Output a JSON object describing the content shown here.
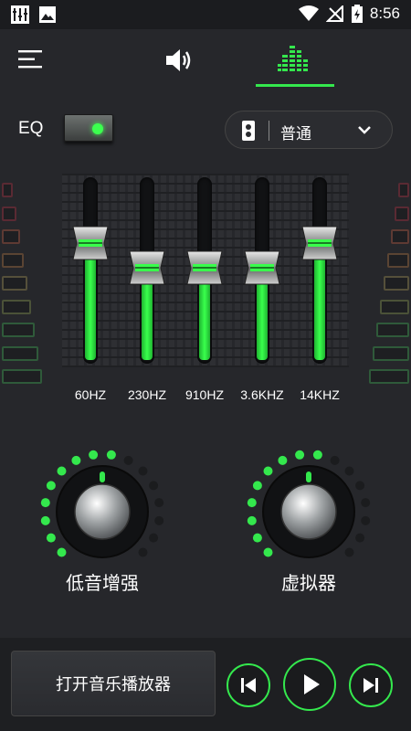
{
  "status_bar": {
    "time": "8:56"
  },
  "header": {
    "tabs": [
      {
        "icon": "speaker-icon",
        "active": false
      },
      {
        "icon": "equalizer-icon",
        "active": true
      }
    ]
  },
  "eq": {
    "label": "EQ",
    "enabled": true,
    "preset": {
      "value": "普通"
    },
    "bands": [
      {
        "label": "60HZ",
        "level": 0.64
      },
      {
        "label": "230HZ",
        "level": 0.5
      },
      {
        "label": "910HZ",
        "level": 0.5
      },
      {
        "label": "3.6KHZ",
        "level": 0.5
      },
      {
        "label": "14KHZ",
        "level": 0.64
      }
    ]
  },
  "knobs": [
    {
      "label": "低音增强",
      "dots_lit": 9,
      "dots_total": 16
    },
    {
      "label": "虚拟器",
      "dots_lit": 9,
      "dots_total": 16
    }
  ],
  "player": {
    "open_label": "打开音乐播放器"
  },
  "colors": {
    "accent": "#34e84d",
    "background": "#26272b"
  }
}
